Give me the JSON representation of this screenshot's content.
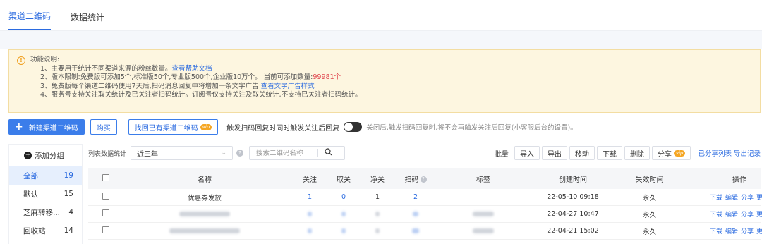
{
  "tabs": [
    {
      "label": "渠道二维码",
      "active": true
    },
    {
      "label": "数据统计",
      "active": false
    }
  ],
  "notice": {
    "title": "功能说明:",
    "line1": "1、主要用于统计不同渠道来源的粉丝数量。",
    "line1_link": "查看帮助文档",
    "line2": "2、版本限制:免费版可添加5个,标准版50个,专业版500个,企业版10万个。 当前可添加数量:",
    "line2_count": "99981个",
    "line3": "3、免费版每个渠道二维码使用7天后,扫码消息回复中将增加一条文字广告",
    "line3_link": "查看文字广告样式",
    "line4": "4、服务号支持关注取关统计及已关注者扫码统计。订阅号仅支持关注及取关统计,不支持已关注者扫码统计。"
  },
  "actions": {
    "create_label": "新建渠道二维码",
    "buy_label": "购买",
    "retrieve_label": "找回已有渠道二维码",
    "vip_badge": "vip",
    "trigger_label": "触发扫码回复时同时触发关注后回复",
    "trigger_desc": "关闭后,触发扫码回复时,将不会再触发关注后回复(小客服后台的设置)。"
  },
  "sidebar": {
    "add_label": "添加分组",
    "groups": [
      {
        "name": "全部",
        "count": "19",
        "active": true
      },
      {
        "name": "默认",
        "count": "15",
        "active": false
      },
      {
        "name": "芝麻转移...",
        "count": "4",
        "active": false
      },
      {
        "name": "回收站",
        "count": "14",
        "active": false
      }
    ]
  },
  "filter": {
    "label": "列表数据统计",
    "range_value": "近三年",
    "search_placeholder": "搜索二维码名称"
  },
  "bulk": {
    "label": "批量",
    "buttons": [
      "导入",
      "导出",
      "移动",
      "下载",
      "删除"
    ],
    "share_label": "分享",
    "links": [
      "已分享列表",
      "导出记录"
    ]
  },
  "table": {
    "headers": {
      "name": "名称",
      "follow": "关注",
      "unfollow": "取关",
      "net": "净关",
      "scan": "扫码",
      "tag": "标签",
      "created": "创建时间",
      "expire": "失效时间",
      "ops": "操作"
    },
    "op_labels": [
      "下载",
      "编辑",
      "分享",
      "更多"
    ],
    "rows": [
      {
        "name": "优惠券发放",
        "follow": "1",
        "unfollow": "0",
        "net": "1",
        "scan": "2",
        "created": "22-05-10 09:18",
        "expire": "永久"
      },
      {
        "name": "",
        "follow": "",
        "unfollow": "",
        "net": "",
        "scan": "",
        "created": "22-04-27 10:47",
        "expire": "永久"
      },
      {
        "name": "",
        "follow": "",
        "unfollow": "",
        "net": "",
        "scan": "",
        "created": "22-04-21 15:02",
        "expire": "永久"
      }
    ]
  },
  "colors": {
    "accent": "#2b6be0",
    "primary_button": "#3b7dea",
    "notice_bg": "#fdf6e0",
    "count_red": "#e0464e"
  },
  "icons": [
    "warning-icon",
    "plus-icon",
    "toggle-switch",
    "help-icon",
    "search-icon",
    "chevron-down-icon"
  ]
}
